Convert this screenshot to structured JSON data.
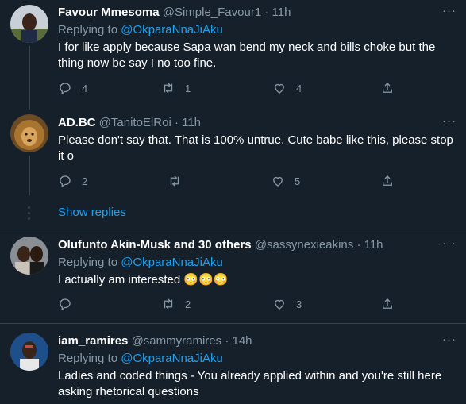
{
  "colors": {
    "background": "#15202b",
    "accent": "#1da1f2",
    "secondary_text": "#8899a6",
    "border": "#38444d"
  },
  "tweets": [
    {
      "name": "Favour Mmesoma",
      "handle": "@Simple_Favour1",
      "time": "· 11h",
      "replying_prefix": "Replying to ",
      "replying_to": "@OkparaNnaJiAku",
      "text": "I for like apply because Sapa wan bend my neck and bills choke but the thing now be say I no too fine.",
      "reply_count": "4",
      "retweet_count": "1",
      "like_count": "4"
    },
    {
      "name": "AD.BC",
      "handle": "@TanitoElRoi",
      "time": "· 11h",
      "text": "Please don't say that. That is 100% untrue. Cute babe like this, please stop it o",
      "reply_count": "2",
      "retweet_count": "",
      "like_count": "5"
    },
    {
      "name": "Olufunto Akin-Musk and 30 others",
      "handle": "@sassynexieakins",
      "time": "· 11h",
      "replying_prefix": "Replying to ",
      "replying_to": "@OkparaNnaJiAku",
      "text": "I actually am interested 😳😳😳",
      "reply_count": "",
      "retweet_count": "2",
      "like_count": "3"
    },
    {
      "name": "iam_ramires",
      "handle": "@sammyramires",
      "time": "· 14h",
      "replying_prefix": "Replying to ",
      "replying_to": "@OkparaNnaJiAku",
      "text": "Ladies and coded things - You already applied within and you're still here asking rhetorical questions"
    }
  ],
  "show_replies": "Show replies",
  "more_label": "···",
  "icons": [
    "reply-icon",
    "retweet-icon",
    "like-icon",
    "share-icon",
    "more-icon"
  ]
}
